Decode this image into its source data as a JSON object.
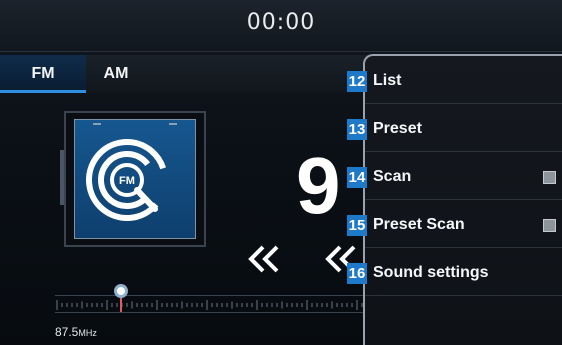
{
  "status_bar": {
    "clock": "00:00"
  },
  "band_tabs": [
    {
      "label": "FM",
      "selected": true
    },
    {
      "label": "AM",
      "selected": false
    }
  ],
  "station": {
    "art_icon": "fm-radio-icon",
    "art_label": "FM",
    "frequency_partial": "9"
  },
  "controls": {
    "seek_prev_icon": "double-chevron-left-icon",
    "seek_back_icon": "chevron-left-icon"
  },
  "tuner": {
    "min_value": "87.5",
    "min_unit": "MHz"
  },
  "menu": {
    "items": [
      {
        "number": "12",
        "label": "List"
      },
      {
        "number": "13",
        "label": "Preset"
      },
      {
        "number": "14",
        "label": "Scan",
        "checkbox": false
      },
      {
        "number": "15",
        "label": "Preset Scan",
        "checkbox": false
      },
      {
        "number": "16",
        "label": "Sound settings"
      }
    ]
  },
  "colors": {
    "accent": "#1f79c9",
    "tab_selected": "#0f2c4a",
    "art_bg": "#16578f"
  }
}
